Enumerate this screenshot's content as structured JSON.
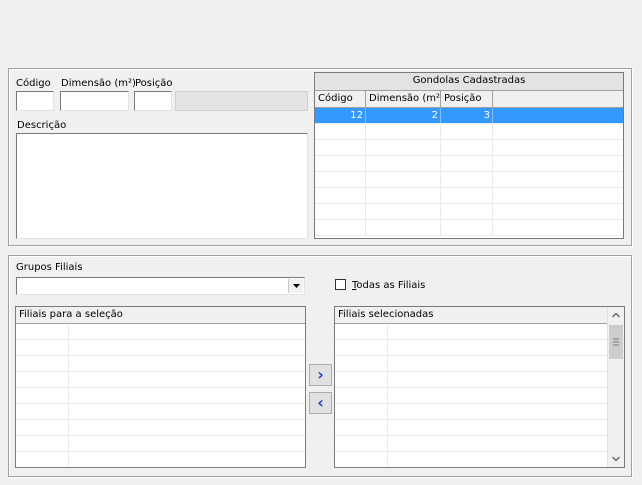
{
  "fields": {
    "codigo_label": "Código",
    "dimensao_label": "Dimensão (m²)",
    "posicao_label": "Posição",
    "descricao_label": "Descrição"
  },
  "gondolas": {
    "title": "Gondolas Cadastradas",
    "columns": [
      "Código",
      "Dimensão (m²)",
      "Posição"
    ],
    "rows": [
      {
        "codigo": "12",
        "dimensao": "2",
        "posicao": "3"
      }
    ]
  },
  "filiais": {
    "grupos_label": "Grupos Filiais",
    "grupos_value": "",
    "todas_label": "Todas as Filiais",
    "todas_underline": "T",
    "todas_rest": "odas as Filiais",
    "disponiveis_header": "Filiais para a seleção",
    "selecionadas_header": "Filiais selecionadas",
    "add_symbol": "›",
    "remove_symbol": "‹"
  },
  "icons": {
    "dropdown": "chevron-down-icon",
    "scroll_up": "chevron-up-icon",
    "scroll_down": "chevron-down-icon"
  }
}
